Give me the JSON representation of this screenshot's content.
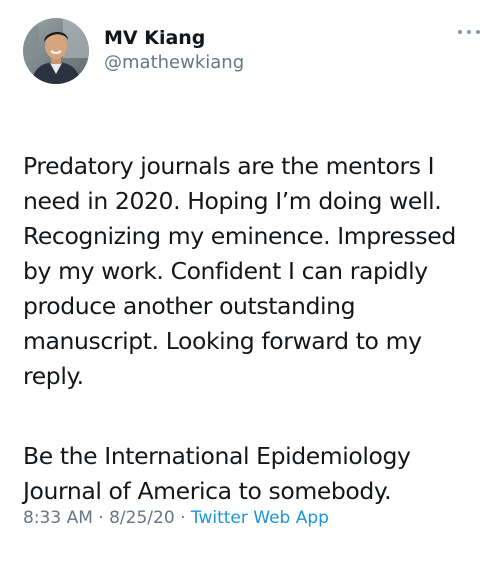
{
  "tweet": {
    "author": {
      "name": "MV Kiang",
      "handle": "@mathewkiang"
    },
    "paragraphs": [
      "Predatory journals are the mentors I\nneed in 2020. Hoping I’m doing well.\nRecognizing my eminence. Impressed\nby my work. Confident I can rapidly\nproduce another outstanding\nmanuscript. Looking forward to my\nreply.",
      "Be the International Epidemiology\nJournal of America to somebody."
    ],
    "time": "8:33 AM",
    "separator": "·",
    "date": "8/25/20",
    "source_app": "Twitter Web App",
    "more_icon": "ellipsis-icon"
  },
  "colors": {
    "text": "#14171a",
    "secondary": "#657786",
    "link": "#1b95e0"
  }
}
